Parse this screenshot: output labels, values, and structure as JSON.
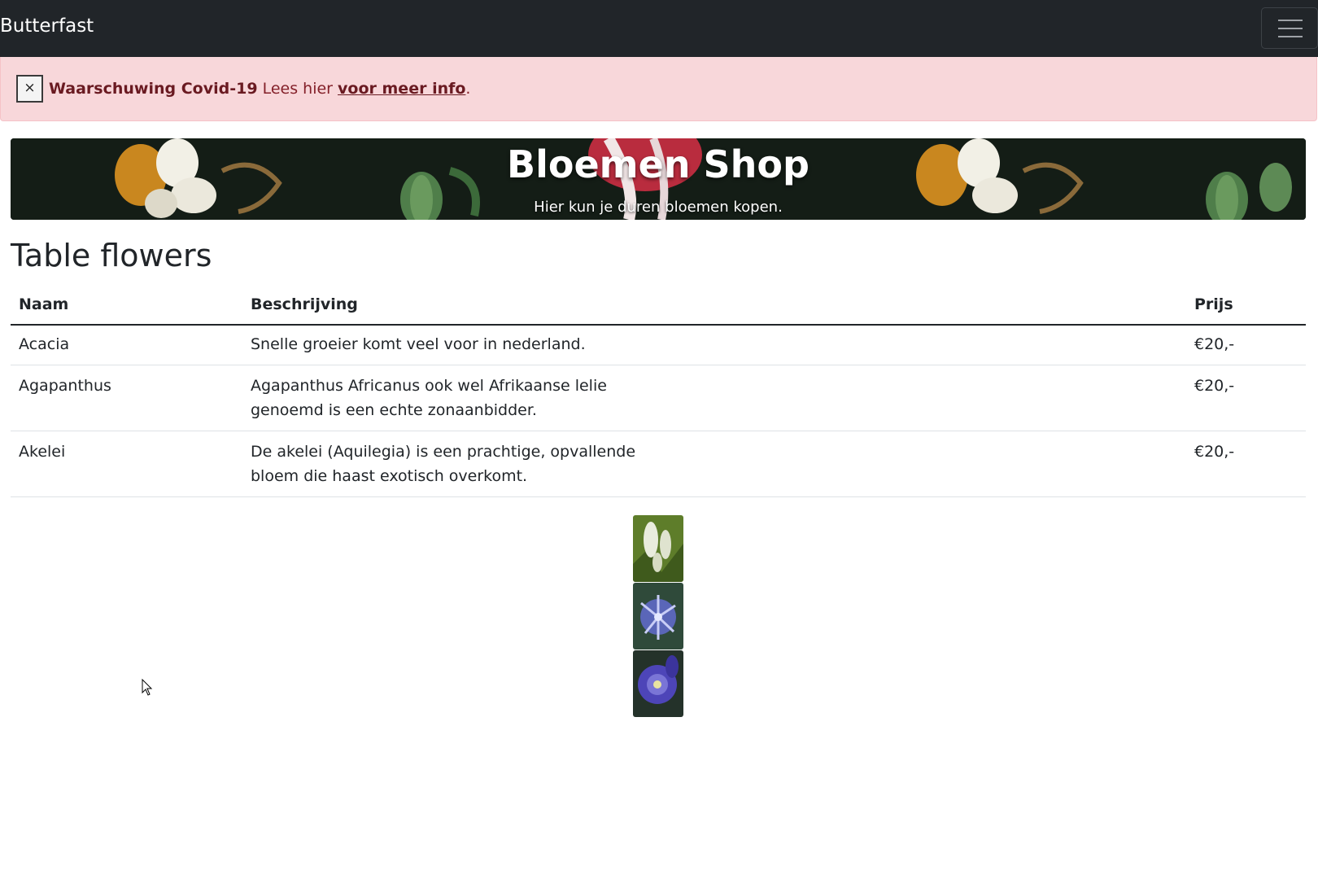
{
  "navbar": {
    "brand": "Butterfast",
    "menu_icon": "hamburger-icon"
  },
  "alert": {
    "close_label": "×",
    "title": "Waarschuwing Covid-19",
    "text": " Lees hier ",
    "link": "voor meer info",
    "suffix": "."
  },
  "hero": {
    "title": "Bloemen Shop",
    "subtitle": "Hier kun je duren bloemen kopen."
  },
  "section": {
    "title": "Table flowers"
  },
  "table": {
    "headers": [
      "Naam",
      "Beschrijving",
      "Prijs"
    ],
    "rows": [
      {
        "name": "Acacia",
        "description": "Snelle groeier komt veel voor in nederland.",
        "price": "€20,-"
      },
      {
        "name": "Agapanthus",
        "description": "Agapanthus Africanus ook wel Afrikaanse lelie genoemd is een echte zonaanbidder.",
        "price": "€20,-"
      },
      {
        "name": "Akelei",
        "description": "De akelei (Aquilegia) is een prachtige, opvallende bloem die haast exotisch overkomt.",
        "price": "€20,-"
      }
    ]
  },
  "images": [
    {
      "subject": "acacia-flower",
      "colors": [
        "#5e7d2a",
        "#e9ecdd"
      ]
    },
    {
      "subject": "agapanthus-flower",
      "colors": [
        "#2f4a3a",
        "#8b93e0"
      ]
    },
    {
      "subject": "akelei-flower",
      "colors": [
        "#24322a",
        "#4d45b8"
      ]
    }
  ],
  "colors": {
    "navbar": "#212529",
    "alert_bg": "#f8d7da",
    "alert_text": "#842029"
  }
}
